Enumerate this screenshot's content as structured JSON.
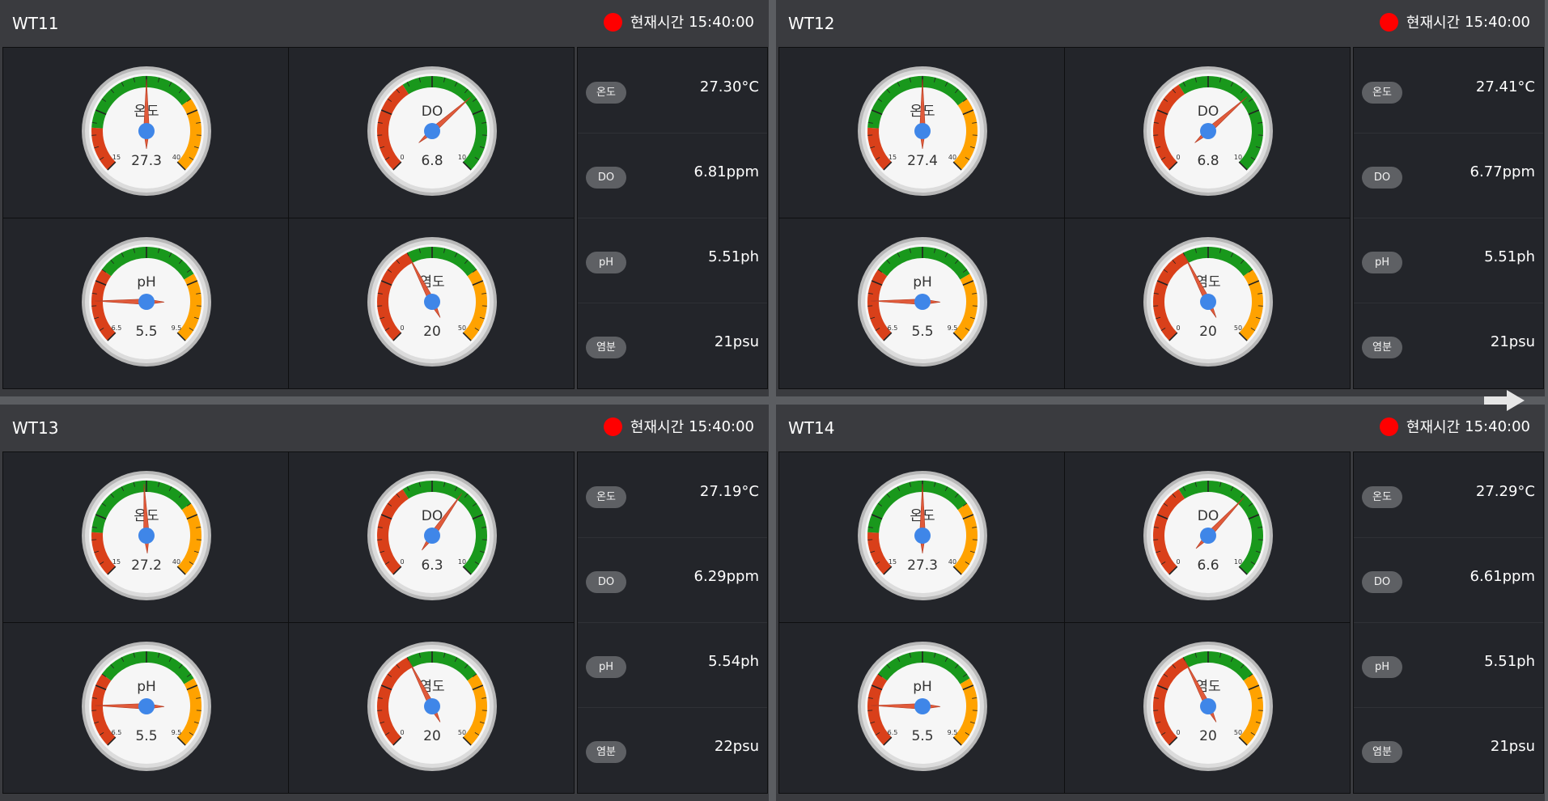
{
  "colors": {
    "danger": "#d9401a",
    "good": "#19981c",
    "warn": "#ffa200",
    "needle": "#e05a3a",
    "hub": "#3f86e8",
    "status_dot": "#ff0000"
  },
  "panels": [
    {
      "title": "WT11",
      "clock": {
        "label": "현재시간",
        "time": "15:40:00"
      },
      "gauges": [
        {
          "label": "온도",
          "value_text": "27.3",
          "value": 27.3,
          "min": 10,
          "max": 45,
          "min_label": "15",
          "max_label": "40",
          "needle_frac": 0.5,
          "bands": "temp"
        },
        {
          "label": "DO",
          "value_text": "6.8",
          "value": 6.8,
          "min": 0,
          "max": 10,
          "min_label": "0",
          "max_label": "10",
          "needle_frac": 0.68,
          "bands": "do"
        },
        {
          "label": "pH",
          "value_text": "5.5",
          "value": 5.5,
          "min": 4.5,
          "max": 10.5,
          "min_label": "6.5",
          "max_label": "9.5",
          "needle_frac": 0.17,
          "bands": "ph"
        },
        {
          "label": "염도",
          "value_text": "20",
          "value": 20,
          "min": 0,
          "max": 50,
          "min_label": "0",
          "max_label": "50",
          "needle_frac": 0.4,
          "bands": "salt"
        }
      ],
      "readings": [
        {
          "badge": "온도",
          "value": "27.30°C"
        },
        {
          "badge": "DO",
          "value": "6.81ppm"
        },
        {
          "badge": "pH",
          "value": "5.51ph"
        },
        {
          "badge": "염분",
          "value": "21psu"
        }
      ]
    },
    {
      "title": "WT12",
      "clock": {
        "label": "현재시간",
        "time": "15:40:00"
      },
      "gauges": [
        {
          "label": "온도",
          "value_text": "27.4",
          "value": 27.4,
          "min": 10,
          "max": 45,
          "min_label": "15",
          "max_label": "40",
          "needle_frac": 0.5,
          "bands": "temp"
        },
        {
          "label": "DO",
          "value_text": "6.8",
          "value": 6.8,
          "min": 0,
          "max": 10,
          "min_label": "0",
          "max_label": "10",
          "needle_frac": 0.68,
          "bands": "do"
        },
        {
          "label": "pH",
          "value_text": "5.5",
          "value": 5.5,
          "min": 4.5,
          "max": 10.5,
          "min_label": "6.5",
          "max_label": "9.5",
          "needle_frac": 0.17,
          "bands": "ph"
        },
        {
          "label": "염도",
          "value_text": "20",
          "value": 20,
          "min": 0,
          "max": 50,
          "min_label": "0",
          "max_label": "50",
          "needle_frac": 0.4,
          "bands": "salt"
        }
      ],
      "readings": [
        {
          "badge": "온도",
          "value": "27.41°C"
        },
        {
          "badge": "DO",
          "value": "6.77ppm"
        },
        {
          "badge": "pH",
          "value": "5.51ph"
        },
        {
          "badge": "염분",
          "value": "21psu"
        }
      ]
    },
    {
      "title": "WT13",
      "clock": {
        "label": "현재시간",
        "time": "15:40:00"
      },
      "gauges": [
        {
          "label": "온도",
          "value_text": "27.2",
          "value": 27.2,
          "min": 10,
          "max": 45,
          "min_label": "15",
          "max_label": "40",
          "needle_frac": 0.49,
          "bands": "temp"
        },
        {
          "label": "DO",
          "value_text": "6.3",
          "value": 6.3,
          "min": 0,
          "max": 10,
          "min_label": "0",
          "max_label": "10",
          "needle_frac": 0.63,
          "bands": "do"
        },
        {
          "label": "pH",
          "value_text": "5.5",
          "value": 5.5,
          "min": 4.5,
          "max": 10.5,
          "min_label": "6.5",
          "max_label": "9.5",
          "needle_frac": 0.17,
          "bands": "ph"
        },
        {
          "label": "염도",
          "value_text": "20",
          "value": 20,
          "min": 0,
          "max": 50,
          "min_label": "0",
          "max_label": "50",
          "needle_frac": 0.4,
          "bands": "salt"
        }
      ],
      "readings": [
        {
          "badge": "온도",
          "value": "27.19°C"
        },
        {
          "badge": "DO",
          "value": "6.29ppm"
        },
        {
          "badge": "pH",
          "value": "5.54ph"
        },
        {
          "badge": "염분",
          "value": "22psu"
        }
      ]
    },
    {
      "title": "WT14",
      "clock": {
        "label": "현재시간",
        "time": "15:40:00"
      },
      "gauges": [
        {
          "label": "온도",
          "value_text": "27.3",
          "value": 27.3,
          "min": 10,
          "max": 45,
          "min_label": "15",
          "max_label": "40",
          "needle_frac": 0.5,
          "bands": "temp"
        },
        {
          "label": "DO",
          "value_text": "6.6",
          "value": 6.6,
          "min": 0,
          "max": 10,
          "min_label": "0",
          "max_label": "10",
          "needle_frac": 0.66,
          "bands": "do"
        },
        {
          "label": "pH",
          "value_text": "5.5",
          "value": 5.5,
          "min": 4.5,
          "max": 10.5,
          "min_label": "6.5",
          "max_label": "9.5",
          "needle_frac": 0.17,
          "bands": "ph"
        },
        {
          "label": "염도",
          "value_text": "20",
          "value": 20,
          "min": 0,
          "max": 50,
          "min_label": "0",
          "max_label": "50",
          "needle_frac": 0.4,
          "bands": "salt"
        }
      ],
      "readings": [
        {
          "badge": "온도",
          "value": "27.29°C"
        },
        {
          "badge": "DO",
          "value": "6.61ppm"
        },
        {
          "badge": "pH",
          "value": "5.51ph"
        },
        {
          "badge": "염분",
          "value": "21psu"
        }
      ]
    }
  ],
  "nav": {
    "icon": "arrow-right-icon"
  }
}
